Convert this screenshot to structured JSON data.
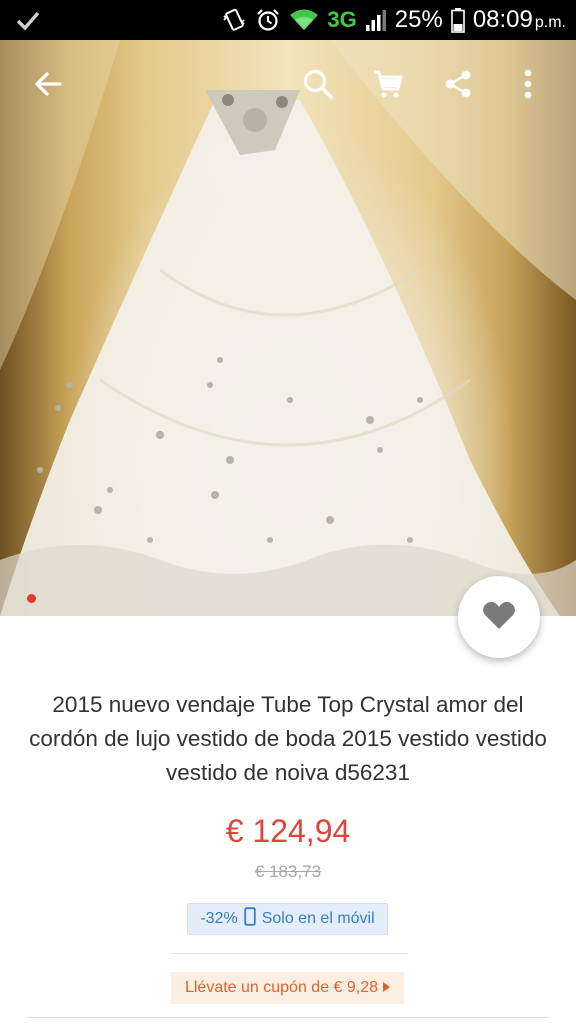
{
  "status_bar": {
    "battery": "25%",
    "time": "08:09",
    "ampm": "p.m.",
    "network": "3G",
    "icons": [
      "check-icon",
      "vibrate-icon",
      "alarm-icon",
      "wifi-icon",
      "signal-icon",
      "battery-icon"
    ]
  },
  "app_bar": {
    "icons": [
      "back-arrow-icon",
      "search-icon",
      "cart-icon",
      "share-icon",
      "more-vert-icon"
    ]
  },
  "product": {
    "title": "2015 nuevo vendaje Tube Top Crystal amor del cordón de lujo vestido de boda 2015 vestido vestido vestido de noiva d56231",
    "price": "€ 124,94",
    "original_price": "€ 183,73",
    "discount": "-32%",
    "mobile_only": "Solo en el móvil",
    "coupon": "Llévate un cupón de € 9,28"
  },
  "colors": {
    "price": "#e0453a",
    "mobile_badge_text": "#3a7dc4",
    "coupon_text": "#e2622b",
    "active_dot": "#e8372d"
  }
}
